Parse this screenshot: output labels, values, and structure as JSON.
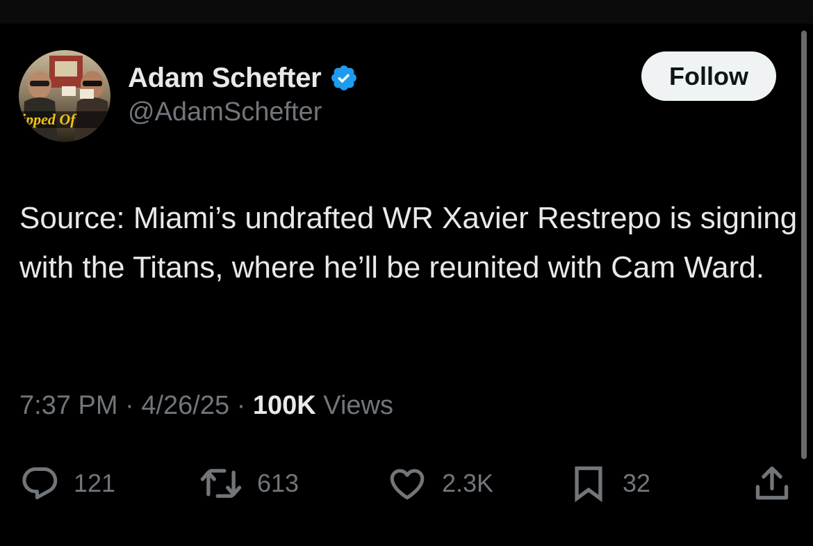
{
  "tweet": {
    "author_name": "Adam Schefter",
    "handle": "@AdamSchefter",
    "verified": true,
    "follow_label": "Follow",
    "text": "Source: Miami’s undrafted WR Xavier Restrepo is signing with the Titans, where he’ll be reunited with Cam Ward.",
    "time": "7:37 PM",
    "date": "4/26/25",
    "views_count": "100K",
    "views_label": "Views",
    "separator": "·"
  },
  "actions": {
    "replies": "121",
    "reposts": "613",
    "likes": "2.3K",
    "bookmarks": "32"
  },
  "colors": {
    "background": "#000000",
    "text_primary": "#e7e9ea",
    "text_secondary": "#71767b",
    "verified_blue": "#1d9bf0",
    "follow_bg": "#eff3f4"
  },
  "icons": {
    "verified": "verified-badge-icon",
    "reply": "reply-icon",
    "repost": "repost-icon",
    "like": "heart-icon",
    "bookmark": "bookmark-icon",
    "share": "share-icon"
  }
}
